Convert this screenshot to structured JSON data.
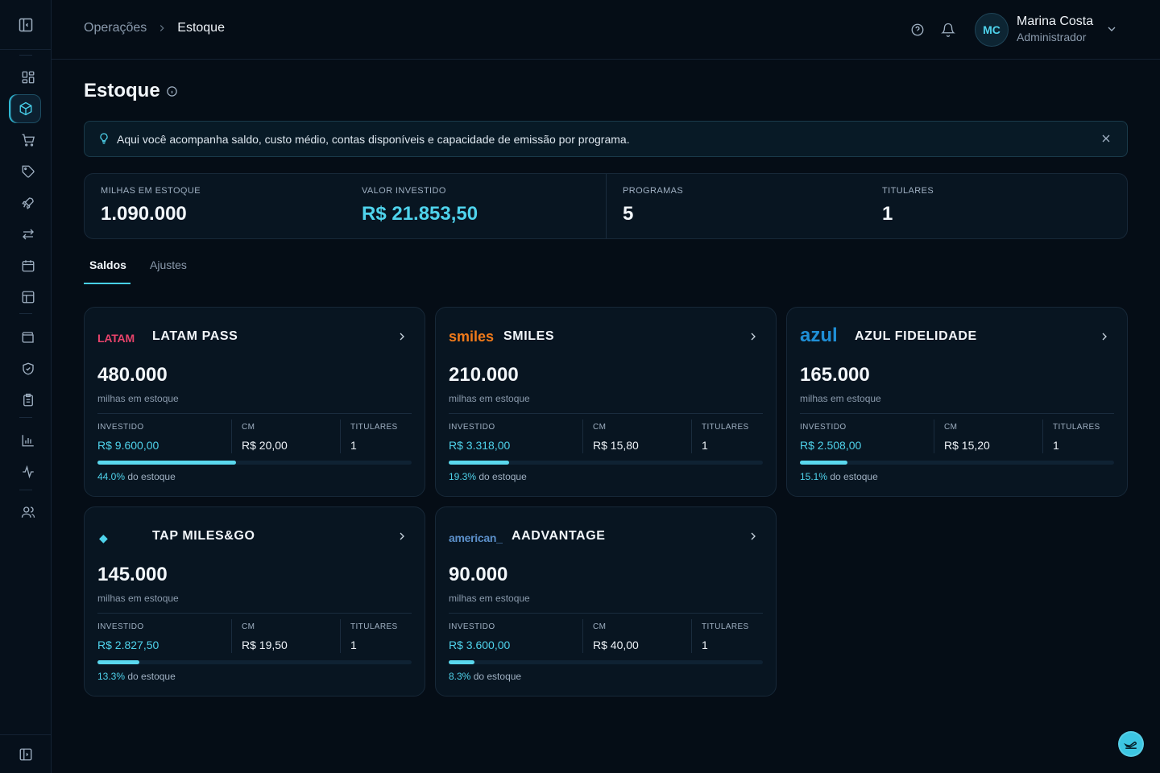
{
  "header": {
    "breadcrumb_parent": "Operações",
    "breadcrumb_current": "Estoque",
    "user": {
      "initials": "MC",
      "name": "Marina Costa",
      "role": "Administrador"
    }
  },
  "page": {
    "title": "Estoque"
  },
  "banner": {
    "text": "Aqui você acompanha saldo, custo médio, contas disponíveis e capacidade de emissão por programa."
  },
  "stats": [
    {
      "label": "MILHAS EM ESTOQUE",
      "value": "1.090.000"
    },
    {
      "label": "VALOR INVESTIDO",
      "value": "R$ 21.853,50"
    },
    {
      "label": "PROGRAMAS",
      "value": "5"
    },
    {
      "label": "TITULARES",
      "value": "1"
    }
  ],
  "tabs": [
    {
      "label": "Saldos",
      "active": true
    },
    {
      "label": "Ajustes",
      "active": false
    }
  ],
  "labels": {
    "miles_sub": "milhas em estoque",
    "invested": "INVESTIDO",
    "cm": "CM",
    "holders": "TITULARES",
    "pct_suffix": "do estoque"
  },
  "cards": [
    {
      "brand": "LATAM",
      "brand_color": "#e8436b",
      "name": "LATAM PASS",
      "miles": "480.000",
      "invested": "R$ 9.600,00",
      "cm": "R$ 20,00",
      "holders": "1",
      "pct_text": "44.0%",
      "pct": 44.0
    },
    {
      "brand": "smiles",
      "brand_color": "#f07a1a",
      "name": "SMILES",
      "miles": "210.000",
      "invested": "R$ 3.318,00",
      "cm": "R$ 15,80",
      "holders": "1",
      "pct_text": "19.3%",
      "pct": 19.3
    },
    {
      "brand": "azul",
      "brand_color": "#1f8fd6",
      "name": "AZUL FIDELIDADE",
      "miles": "165.000",
      "invested": "R$ 2.508,00",
      "cm": "R$ 15,20",
      "holders": "1",
      "pct_text": "15.1%",
      "pct": 15.1
    },
    {
      "brand": "◆",
      "brand_color": "#4fd3ec",
      "name": "TAP MILES&GO",
      "miles": "145.000",
      "invested": "R$ 2.827,50",
      "cm": "R$ 19,50",
      "holders": "1",
      "pct_text": "13.3%",
      "pct": 13.3
    },
    {
      "brand": "american_",
      "brand_color": "#5b8fc9",
      "name": "AADVANTAGE",
      "miles": "90.000",
      "invested": "R$ 3.600,00",
      "cm": "R$ 40,00",
      "holders": "1",
      "pct_text": "8.3%",
      "pct": 8.3
    }
  ],
  "colors": {
    "accent": "#4fd3ec",
    "background": "#050d16",
    "card": "#081521"
  }
}
